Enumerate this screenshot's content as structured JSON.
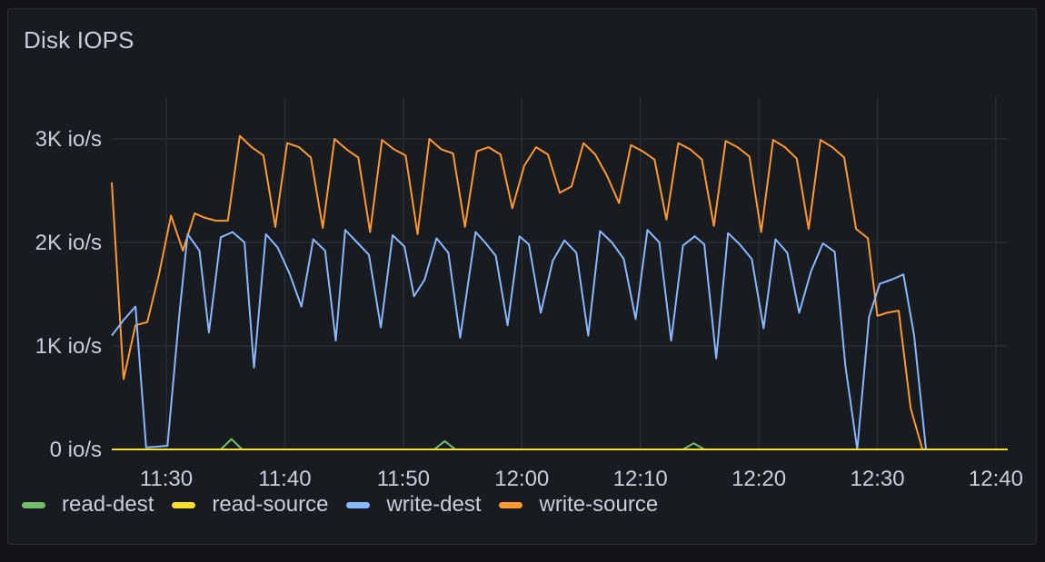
{
  "panel": {
    "title": "Disk IOPS"
  },
  "chart_data": {
    "type": "line",
    "title": "Disk IOPS",
    "xlabel": "",
    "ylabel": "",
    "x_ticks": [
      "11:30",
      "11:40",
      "11:50",
      "12:00",
      "12:10",
      "12:20",
      "12:30",
      "12:40"
    ],
    "x_tick_minutes": [
      30,
      40,
      50,
      60,
      70,
      80,
      90,
      100
    ],
    "xlim_minutes": [
      25.4,
      101.0
    ],
    "y_ticks": [
      0,
      1000,
      2000,
      3000
    ],
    "y_tick_labels": [
      "0 io/s",
      "1K io/s",
      "2K io/s",
      "3K io/s"
    ],
    "ylim": [
      0,
      3000
    ],
    "grid": true,
    "legend_position": "bottom-left",
    "series": [
      {
        "name": "read-dest",
        "color": "#73bf69",
        "x": [
          25.4,
          34.6,
          35.5,
          36.4,
          52.6,
          53.5,
          54.4,
          73.6,
          74.5,
          75.4,
          101.0
        ],
        "y": [
          0,
          0,
          100,
          0,
          0,
          80,
          0,
          0,
          60,
          0,
          0
        ]
      },
      {
        "name": "read-source",
        "color": "#fade2a",
        "x": [
          25.4,
          101.0
        ],
        "y": [
          0,
          0
        ]
      },
      {
        "name": "write-dest",
        "color": "#8ab8ff",
        "x": [
          25.4,
          26.4,
          27.4,
          28.3,
          29.1,
          30.1,
          31.1,
          31.8,
          32.8,
          33.6,
          34.6,
          35.6,
          36.6,
          37.4,
          38.4,
          39.4,
          40.4,
          41.4,
          42.4,
          43.4,
          44.3,
          45.1,
          46.1,
          47.1,
          48.1,
          49.1,
          50.1,
          50.9,
          51.8,
          52.8,
          53.8,
          54.8,
          56.1,
          56.9,
          57.8,
          58.8,
          59.8,
          60.6,
          61.6,
          62.6,
          63.6,
          64.6,
          65.6,
          66.6,
          67.6,
          68.6,
          69.6,
          70.6,
          71.6,
          72.6,
          73.6,
          74.6,
          75.4,
          76.4,
          77.4,
          78.4,
          79.4,
          80.4,
          81.4,
          82.4,
          83.4,
          84.4,
          85.4,
          86.4,
          87.3,
          88.3,
          89.3,
          90.2,
          91.2,
          92.2,
          93.1,
          94.1,
          95.1,
          96.1,
          101.0
        ],
        "y": [
          1100,
          1250,
          1380,
          20,
          25,
          35,
          1300,
          2080,
          1920,
          1130,
          2050,
          2100,
          2000,
          790,
          2080,
          1950,
          1700,
          1380,
          2030,
          1920,
          1050,
          2120,
          2000,
          1880,
          1180,
          2070,
          1960,
          1480,
          1640,
          2040,
          1900,
          1080,
          2100,
          2000,
          1870,
          1200,
          2060,
          1980,
          1320,
          1820,
          2020,
          1900,
          1100,
          2110,
          2000,
          1840,
          1260,
          2120,
          2000,
          1050,
          1970,
          2060,
          1980,
          880,
          2090,
          1980,
          1840,
          1170,
          2030,
          1900,
          1320,
          1720,
          1990,
          1910,
          810,
          0,
          1280,
          1600,
          1640,
          1690,
          1100,
          0,
          0,
          0,
          0
        ]
      },
      {
        "name": "write-source",
        "color": "#ff9830",
        "x": [
          25.4,
          26.4,
          27.4,
          28.4,
          29.4,
          30.4,
          31.4,
          32.4,
          33.2,
          34.2,
          35.2,
          36.2,
          37.2,
          38.2,
          39.2,
          40.2,
          41.2,
          42.2,
          43.2,
          44.2,
          45.2,
          46.2,
          47.2,
          48.2,
          49.2,
          50.2,
          51.2,
          52.2,
          53.2,
          54.2,
          55.2,
          56.2,
          57.2,
          58.2,
          59.2,
          60.2,
          61.2,
          62.2,
          63.2,
          64.2,
          65.2,
          66.2,
          67.2,
          68.2,
          69.2,
          70.2,
          71.2,
          72.2,
          73.2,
          74.2,
          75.2,
          76.2,
          77.2,
          78.2,
          79.2,
          80.2,
          81.2,
          82.2,
          83.2,
          84.2,
          85.2,
          86.2,
          87.2,
          88.2,
          89.2,
          90.0,
          90.8,
          91.8,
          92.8,
          93.8,
          101.0
        ],
        "y": [
          2580,
          680,
          1200,
          1230,
          1700,
          2260,
          1920,
          2280,
          2240,
          2210,
          2210,
          3030,
          2920,
          2840,
          2150,
          2960,
          2920,
          2820,
          2140,
          3000,
          2900,
          2820,
          2100,
          2990,
          2900,
          2840,
          2080,
          3000,
          2900,
          2860,
          2150,
          2880,
          2920,
          2850,
          2330,
          2740,
          2920,
          2850,
          2480,
          2540,
          2960,
          2850,
          2640,
          2380,
          2940,
          2880,
          2800,
          2220,
          2960,
          2900,
          2800,
          2160,
          2980,
          2920,
          2830,
          2100,
          2990,
          2920,
          2810,
          2130,
          2990,
          2920,
          2820,
          2130,
          2040,
          1290,
          1320,
          1340,
          400,
          0,
          0
        ]
      }
    ]
  }
}
